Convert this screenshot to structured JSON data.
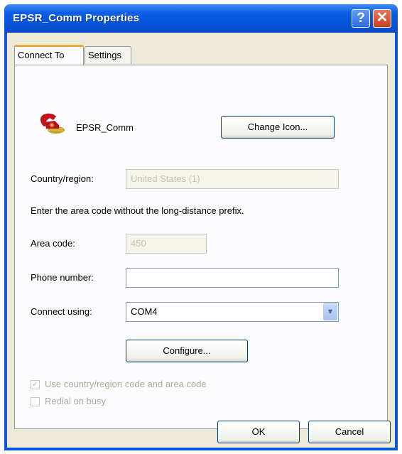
{
  "window": {
    "title": "EPSR_Comm Properties",
    "help_glyph": "?",
    "close_glyph": "✕"
  },
  "tabs": [
    {
      "label": "Connect To",
      "active": true
    },
    {
      "label": "Settings",
      "active": false
    }
  ],
  "connection": {
    "name": "EPSR_Comm",
    "change_icon_label": "Change Icon..."
  },
  "country": {
    "label": "Country/region:",
    "value": "United States (1)",
    "enabled": false
  },
  "instruction": "Enter the area code without the long-distance prefix.",
  "area_code": {
    "label": "Area code:",
    "value": "450",
    "enabled": false
  },
  "phone_number": {
    "label": "Phone number:",
    "value": ""
  },
  "connect_using": {
    "label": "Connect using:",
    "value": "COM4"
  },
  "configure_label": "Configure...",
  "use_country_code": {
    "label": "Use country/region code and area code",
    "checked": true,
    "enabled": false
  },
  "redial_on_busy": {
    "label": "Redial on busy",
    "checked": false,
    "enabled": false
  },
  "footer": {
    "ok_label": "OK",
    "cancel_label": "Cancel"
  },
  "colors": {
    "titlebar": "#0a57d8",
    "dialog_face": "#ece9d8",
    "tab_highlight": "#f0a73c",
    "close_button": "#c8401f"
  },
  "icons": {
    "app": "red-telephone-icon",
    "combo": "chevron-down-icon"
  }
}
